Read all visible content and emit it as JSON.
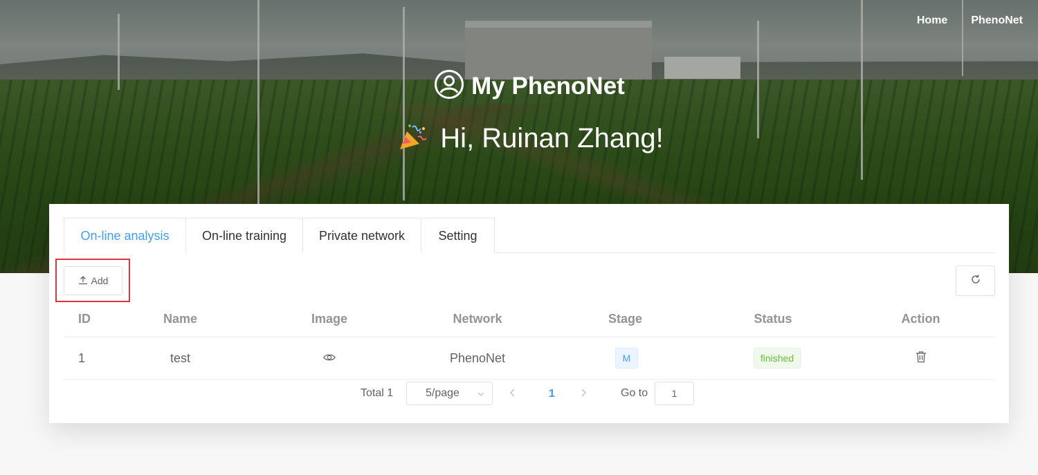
{
  "nav": {
    "home": "Home",
    "phenonet": "PhenoNet"
  },
  "hero": {
    "title": "My PhenoNet",
    "greeting": "Hi, Ruinan Zhang!",
    "user_icon": "user-circle-icon",
    "party_icon": "party-popper-icon"
  },
  "tabs": [
    {
      "label": "On-line analysis",
      "active": true
    },
    {
      "label": "On-line training",
      "active": false
    },
    {
      "label": "Private network",
      "active": false
    },
    {
      "label": "Setting",
      "active": false
    }
  ],
  "toolbar": {
    "add_label": "Add",
    "add_icon": "upload-icon",
    "refresh_icon": "refresh-icon"
  },
  "table": {
    "headers": [
      "ID",
      "Name",
      "Image",
      "Network",
      "Stage",
      "Status",
      "Action"
    ],
    "rows": [
      {
        "id": "1",
        "name": "test",
        "image_icon": "eye-icon",
        "network": "PhenoNet",
        "stage": "M",
        "status": "finished",
        "action_icon": "delete-icon"
      }
    ]
  },
  "pagination": {
    "total_text": "Total 1",
    "page_size": "5/page",
    "current_page": "1",
    "goto_label": "Go to",
    "goto_value": "1"
  },
  "colors": {
    "accent": "#409eff",
    "success": "#67c23a",
    "highlight": "#d9363e"
  }
}
